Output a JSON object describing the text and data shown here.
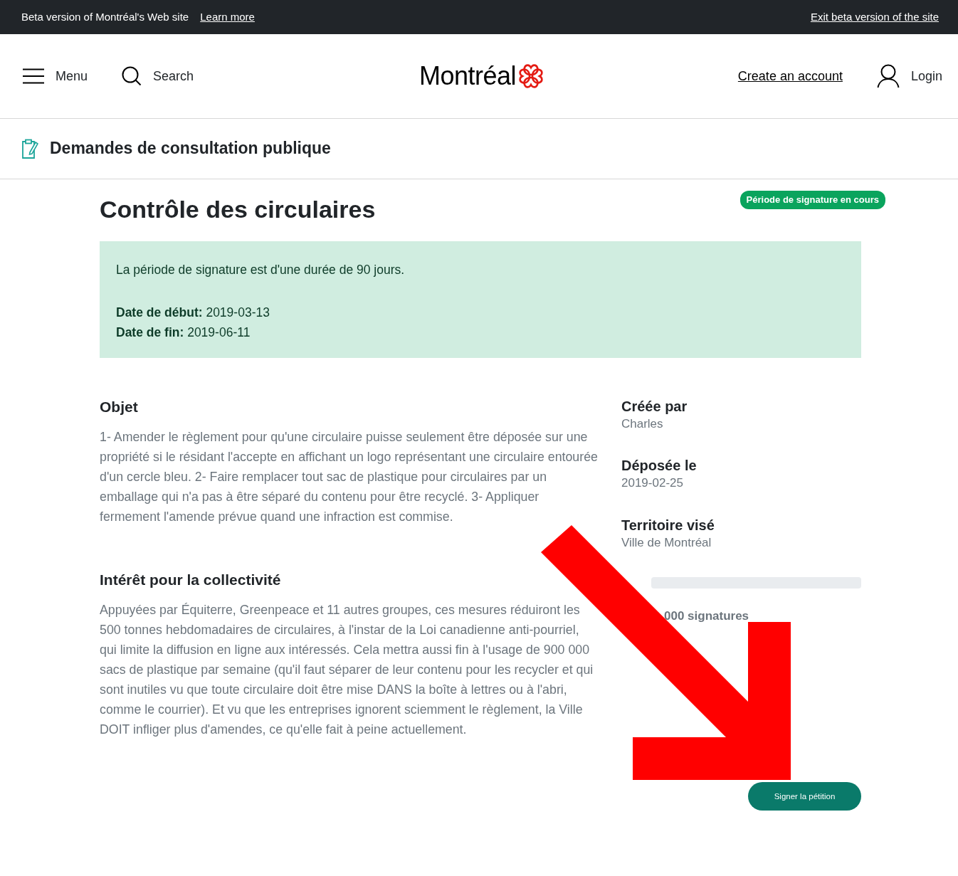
{
  "beta_bar": {
    "text": "Beta version of Montréal's Web site",
    "learn_more": "Learn more",
    "exit": "Exit beta version of the site"
  },
  "header": {
    "menu": "Menu",
    "search": "Search",
    "logo": "Montréal",
    "create_account": "Create an account",
    "login": "Login"
  },
  "section": {
    "title": "Demandes de consultation publique"
  },
  "petition": {
    "title": "Contrôle des circulaires",
    "status": "Période de signature en cours",
    "notice": {
      "text": "La période de signature est d'une durée de 90 jours.",
      "lines": [
        "**Date de début:** 2019-03-13",
        "**Date de fin:** 2019-06-11"
      ]
    },
    "sections": [
      {
        "heading": "Objet",
        "body": "1- Amender le règlement pour qu'une circulaire puisse seulement être déposée sur une propriété si le résidant l'accepte en affichant un logo représentant une circulaire entourée d'un cercle bleu. 2- Faire remplacer tout sac de plastique pour circulaires par un emballage qui n'a pas à être séparé du contenu pour être recyclé. 3- Appliquer fermement l'amende prévue quand une infraction est commise."
      },
      {
        "heading": "Intérêt pour la collectivité",
        "body": "Appuyées par Équiterre, Greenpeace et 11 autres groupes, ces mesures réduiront les 500 tonnes hebdomadaires de circulaires, à l'instar de la Loi canadienne anti-pourriel, qui limite la diffusion en ligne aux intéressés. Cela mettra aussi fin à l'usage de 900 000 sacs de plastique par semaine (qu'il faut séparer de leur contenu pour les recycler et qui sont inutiles vu que toute circulaire doit être mise DANS la boîte à lettres ou à l'abri, comme le courrier). Et vu que les entreprises ignorent sciemment le règlement, la Ville DOIT infliger plus d'amendes, ce qu'elle fait à peine actuellement."
      }
    ],
    "facts": [
      {
        "label": "Créée par",
        "value": "Charles"
      },
      {
        "label": "Déposée le",
        "value": "2019-02-25"
      },
      {
        "label": "Territoire visé",
        "value": "Ville de Montréal"
      }
    ],
    "progress": {
      "level": 0,
      "text": "000 signatures"
    },
    "sign_button": "Signer la pétition"
  }
}
